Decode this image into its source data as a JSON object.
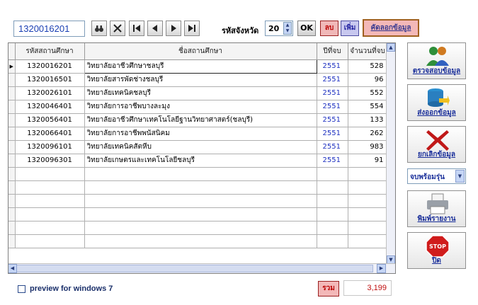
{
  "toolbar": {
    "code_value": "1320016201",
    "province_label": "รหัสจังหวัด",
    "province_value": "20",
    "ok_label": "OK",
    "delete_label": "ลบ",
    "add_label": "เพิ่ม",
    "copy_label": "คัดลอกข้อมูล"
  },
  "grid": {
    "columns": [
      "รหัสสถานศึกษา",
      "ชื่อสถานศึกษา",
      "ปีที่จบ",
      "จำนวนที่จบ"
    ],
    "rows": [
      {
        "code": "1320016201",
        "name": "วิทยาลัยอาชีวศึกษาชลบุรี",
        "year": "2551",
        "count": "528"
      },
      {
        "code": "1320016501",
        "name": "วิทยาลัยสารพัดช่างชลบุรี",
        "year": "2551",
        "count": "96"
      },
      {
        "code": "1320026101",
        "name": "วิทยาลัยเทคนิคชลบุรี",
        "year": "2551",
        "count": "552"
      },
      {
        "code": "1320046401",
        "name": "วิทยาลัยการอาชีพบางละมุง",
        "year": "2551",
        "count": "554"
      },
      {
        "code": "1320056401",
        "name": "วิทยาลัยอาชีวศึกษาเทคโนโลยีฐานวิทยาศาสตร์(ชลบุรี)",
        "year": "2551",
        "count": "133"
      },
      {
        "code": "1320066401",
        "name": "วิทยาลัยการอาชีพพนัสนิคม",
        "year": "2551",
        "count": "262"
      },
      {
        "code": "1320096101",
        "name": "วิทยาลัยเทคนิคสัตหีบ",
        "year": "2551",
        "count": "983"
      },
      {
        "code": "1320096301",
        "name": "วิทยาลัยเกษตรและเทคโนโลยีชลบุรี",
        "year": "2551",
        "count": "91"
      }
    ],
    "empty_rows": 6
  },
  "side": {
    "check_label": "ตรวจสอบข้อมูล",
    "export_label": "ส่งออกข้อมูล",
    "cancel_label": "ยกเลิกข้อมูล",
    "combo_value": "จบพร้อมรุ่น",
    "print_label": "พิมพ์รายงาน",
    "close_label": "ปิด",
    "stop_text": "STOP"
  },
  "footer": {
    "preview_label": "preview for windows 7",
    "sum_label": "รวม",
    "sum_value": "3,199"
  }
}
